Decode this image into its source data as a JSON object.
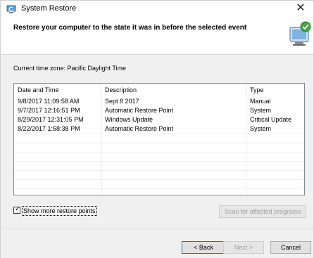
{
  "window": {
    "title": "System Restore"
  },
  "header": {
    "heading": "Restore your computer to the state it was in before the selected event"
  },
  "timezone": "Current time zone: Pacific Daylight Time",
  "table": {
    "columns": [
      "Date and Time",
      "Description",
      "Type"
    ],
    "rows": [
      [
        "9/8/2017 11:09:58 AM",
        "Sept 8 2017",
        "Manual"
      ],
      [
        "9/7/2017 12:16:51 PM",
        "Automatic Restore Point",
        "System"
      ],
      [
        "8/29/2017 12:31:05 PM",
        "Windows Update",
        "Critical Update"
      ],
      [
        "8/22/2017 1:58:38 PM",
        "Automatic Restore Point",
        "System"
      ]
    ]
  },
  "show_more": {
    "label": "Show more restore points",
    "checked": true
  },
  "buttons": {
    "scan": "Scan for affected programs",
    "back": "< Back",
    "next": "Next >",
    "cancel": "Cancel"
  },
  "icons": {
    "app": "system-restore-icon",
    "header": "restore-monitor-icon",
    "close": "close-icon"
  }
}
